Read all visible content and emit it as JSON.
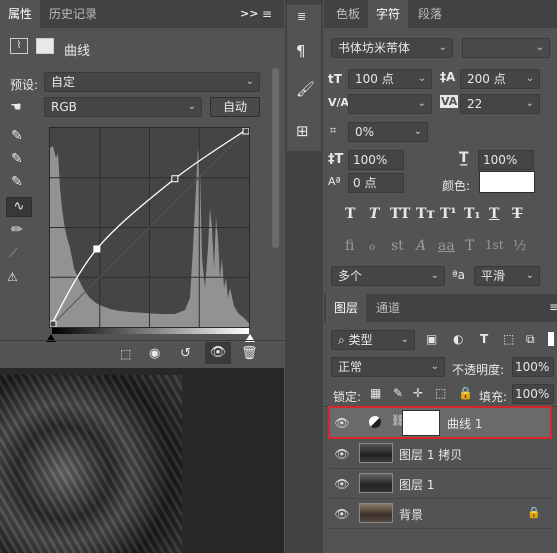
{
  "left_panel": {
    "tabs": [
      "属性",
      "历史记录"
    ],
    "collapse_glyph": ">>",
    "header_title": "曲线",
    "preset_label": "预设:",
    "preset_value": "自定",
    "channel_value": "RGB",
    "auto_button": "自动"
  },
  "curve": {
    "points": [
      [
        0,
        0
      ],
      [
        60,
        100
      ],
      [
        160,
        190
      ],
      [
        255,
        255
      ]
    ]
  },
  "middle_toolbar": {
    "icons": [
      "paragraph-styles-icon",
      "character-styles-icon",
      "brush-settings-icon",
      "adjustments-icon"
    ]
  },
  "character_panel": {
    "tabs": [
      "色板",
      "字符",
      "段落"
    ],
    "font_family": "书体坊米芾体",
    "font_size": "100 点",
    "leading": "200 点",
    "tracking": "22",
    "scale_percent": "0%",
    "vertical_scale": "100%",
    "horizontal_scale": "100%",
    "baseline_shift": "0 点",
    "color_label": "颜色:",
    "color_value": "#ffffff",
    "style_buttons": [
      "T",
      "T",
      "TT",
      "Tт",
      "T¹",
      "T₁",
      "T",
      "T"
    ],
    "opentype_buttons": [
      "fi",
      "ℴ",
      "st",
      "A",
      "aa",
      "T",
      "1st",
      "½"
    ],
    "language": "多个",
    "aa_icon": "ªa",
    "antialias": "平滑"
  },
  "layers_panel": {
    "tabs": [
      "图层",
      "通道"
    ],
    "filter_value": "类型",
    "blend_mode": "正常",
    "opacity_label": "不透明度:",
    "opacity_value": "100%",
    "lock_label": "锁定:",
    "fill_label": "填充:",
    "fill_value": "100%",
    "layers": [
      {
        "name": "曲线 1",
        "kind": "adjustment",
        "selected": true
      },
      {
        "name": "图层 1 拷贝",
        "kind": "image"
      },
      {
        "name": "图层 1",
        "kind": "image"
      },
      {
        "name": "背景",
        "kind": "image",
        "locked": true
      }
    ],
    "selection_color": "#d8262c"
  }
}
